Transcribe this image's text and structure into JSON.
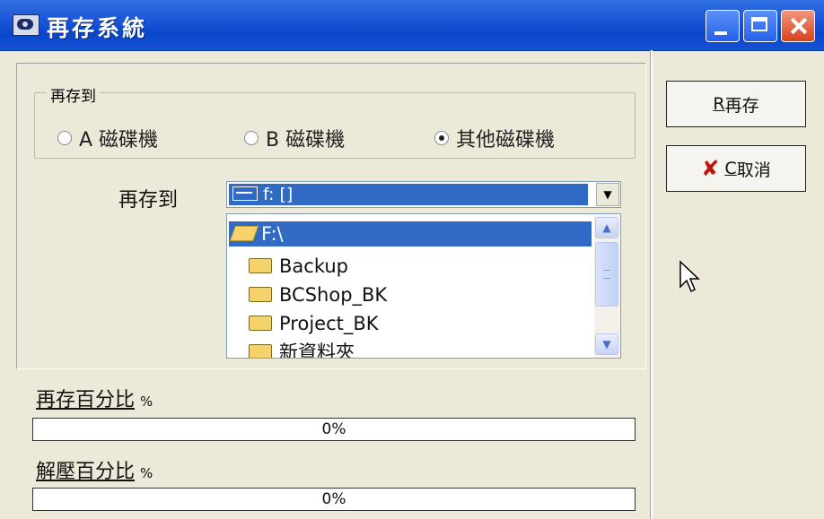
{
  "window": {
    "title": "再存系統"
  },
  "restore_group": {
    "label": "再存到",
    "options": [
      {
        "label": "A 磁碟機",
        "selected": false
      },
      {
        "label": "B 磁碟機",
        "selected": false
      },
      {
        "label": "其他磁碟機",
        "selected": true
      }
    ]
  },
  "target": {
    "label": "再存到",
    "drive_value": "f: []"
  },
  "folders": {
    "current": "F:\\",
    "items": [
      "Backup",
      "BCShop_BK",
      "Project_BK",
      "新資料夾"
    ]
  },
  "progress": {
    "restore": {
      "label": "再存百分比",
      "unit": "%",
      "text": "0%",
      "value": 0
    },
    "decompress": {
      "label": "解壓百分比",
      "unit": "%",
      "text": "0%",
      "value": 0
    }
  },
  "buttons": {
    "restore": {
      "accel": "R",
      "label": "再存"
    },
    "cancel": {
      "accel": "C",
      "label": "取消"
    }
  },
  "colors": {
    "titlebar": "#0a46c8",
    "selection": "#316ac5",
    "face": "#ece9d8",
    "cancel_icon": "#c0140c"
  }
}
